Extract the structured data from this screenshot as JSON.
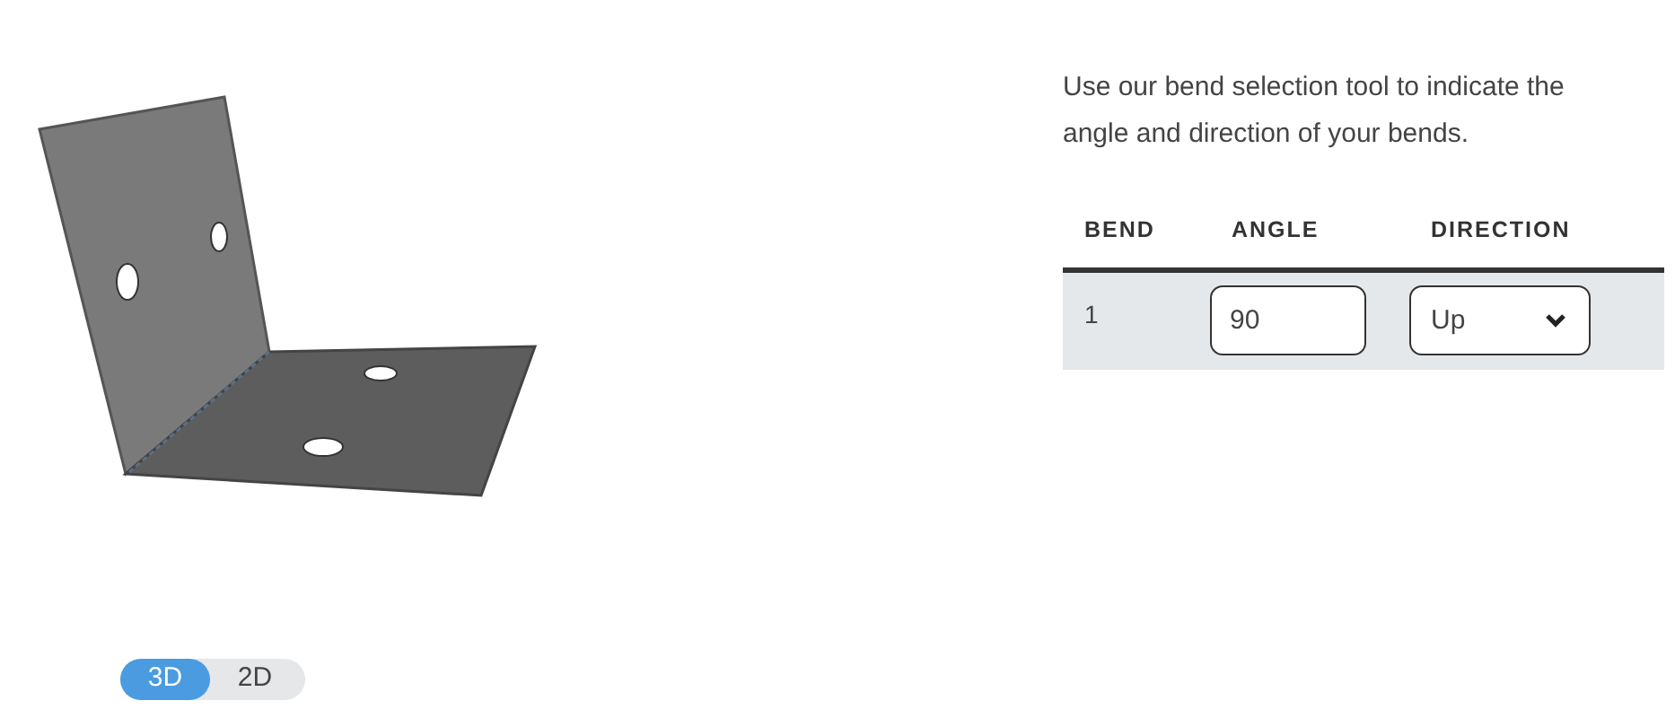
{
  "view_toggle": [
    {
      "label": "3D",
      "selected": true
    },
    {
      "label": "2D",
      "selected": false
    }
  ],
  "intro": "Use our bend selection tool to indicate the angle and direction of your bends.",
  "table": {
    "columns": [
      "BEND",
      "ANGLE",
      "DIRECTION"
    ],
    "rows": [
      {
        "bend": "1",
        "angle": "90",
        "direction": "Up"
      }
    ]
  }
}
